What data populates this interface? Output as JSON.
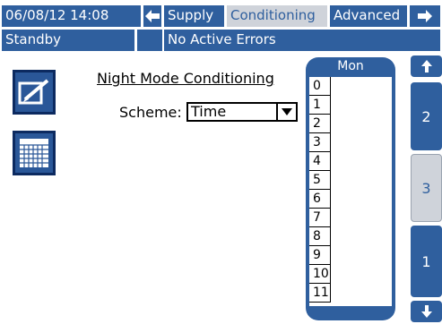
{
  "status_bar": {
    "datetime": "06/08/12 14:08",
    "tabs": [
      {
        "label": "Supply"
      },
      {
        "label": "Conditioning"
      },
      {
        "label": "Advanced"
      }
    ],
    "active_tab": "Conditioning",
    "status": "Standby",
    "errors": "No Active Errors"
  },
  "screen": {
    "title": "Night Mode Conditioning",
    "scheme_label": "Scheme:",
    "scheme_value": "Time"
  },
  "schedule": {
    "day": "Mon",
    "hours": [
      "0",
      "1",
      "2",
      "3",
      "4",
      "5",
      "6",
      "7",
      "8",
      "9",
      "10",
      "11"
    ]
  },
  "pages": {
    "labels": [
      "2",
      "3",
      "1"
    ],
    "active": "3"
  },
  "colors": {
    "accent": "#2f5f9e",
    "active_tab": "#cfd3da"
  },
  "icons": {
    "left_arrow": "arrow-left-icon",
    "right_arrow": "arrow-right-icon",
    "edit": "edit-icon",
    "calendar": "calendar-icon",
    "up": "arrow-up-icon",
    "down": "arrow-down-icon",
    "dropdown": "dropdown-arrow-icon"
  }
}
